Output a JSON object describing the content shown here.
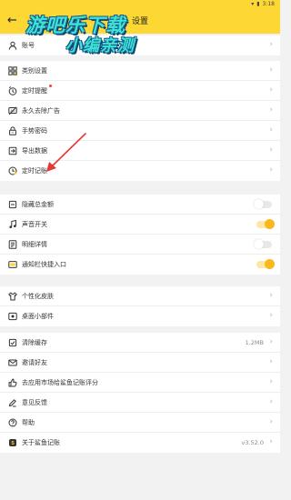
{
  "statusbar": {
    "time": "3:18"
  },
  "header": {
    "back_glyph": "←",
    "title": "设置"
  },
  "watermark": {
    "line1": "游吧乐下载",
    "line2": "小编亲测"
  },
  "groups": [
    {
      "rows": [
        {
          "icon": "user-icon",
          "label": "账号"
        }
      ]
    },
    {
      "rows": [
        {
          "icon": "category-icon",
          "label": "类别设置"
        },
        {
          "icon": "reminder-icon",
          "label": "定时提醒",
          "red_dot": true
        },
        {
          "icon": "ad-block-icon",
          "label": "永久去除广告"
        },
        {
          "icon": "lock-icon",
          "label": "手势密码"
        },
        {
          "icon": "export-icon",
          "label": "导出数据"
        },
        {
          "icon": "scheduled-entry-icon",
          "label": "定时记账"
        }
      ]
    },
    {
      "rows": [
        {
          "icon": "hide-icon",
          "label": "隐藏总金额",
          "toggle": false
        },
        {
          "icon": "music-icon",
          "label": "声音开关",
          "toggle": true
        },
        {
          "icon": "details-icon",
          "label": "明细详情",
          "toggle": false
        },
        {
          "icon": "notification-icon",
          "label": "通知栏快捷入口",
          "toggle": true
        }
      ]
    },
    {
      "rows": [
        {
          "icon": "shirt-icon",
          "label": "个性化皮肤"
        },
        {
          "icon": "widget-icon",
          "label": "桌面小部件"
        }
      ]
    },
    {
      "rows": [
        {
          "icon": "clear-cache-icon",
          "label": "清除缓存",
          "value": "1.2MB"
        },
        {
          "icon": "invite-icon",
          "label": "邀请好友"
        },
        {
          "icon": "thumbs-up-icon",
          "label": "去应用市场给鲨鱼记账评分"
        },
        {
          "icon": "feedback-icon",
          "label": "意见反馈"
        },
        {
          "icon": "help-icon",
          "label": "帮助"
        },
        {
          "icon": "about-icon",
          "label": "关于鲨鱼记账",
          "value": "v3.52.0"
        }
      ]
    }
  ],
  "colors": {
    "accent": "#fdd835",
    "toggle_on": "#f9b81b",
    "arrow": "#e53935"
  }
}
